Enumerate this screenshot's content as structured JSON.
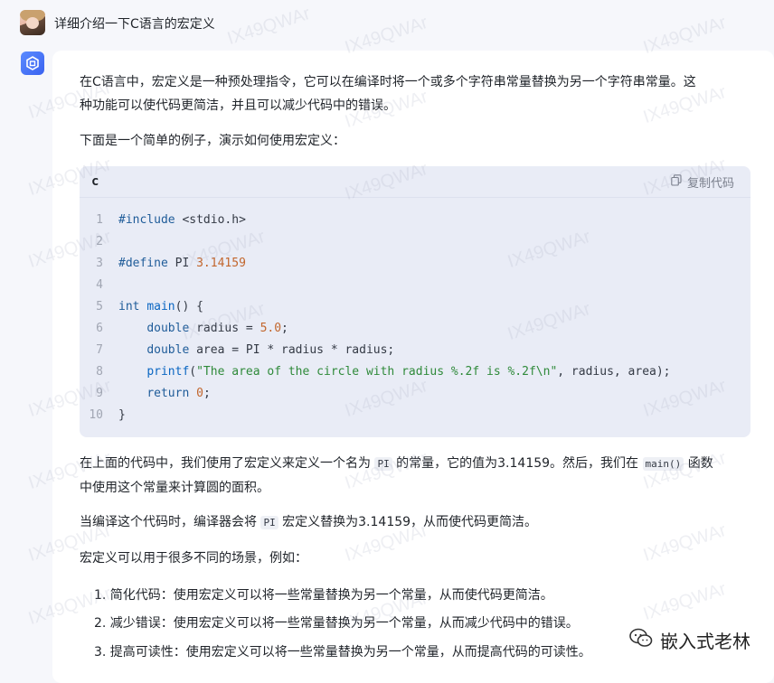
{
  "user": {
    "question": "详细介绍一下C语言的宏定义"
  },
  "answer": {
    "p1_line1": "在C语言中，宏定义是一种预处理指令，它可以在编译时将一个或多个字符串常量替换为另一个字符串常量。这",
    "p1_line2": "种功能可以使代码更简洁，并且可以减少代码中的错误。",
    "p2": "下面是一个简单的例子，演示如何使用宏定义：",
    "code": {
      "language": "c",
      "copy_label": "复制代码",
      "line_numbers": [
        "1",
        "2",
        "3",
        "4",
        "5",
        "6",
        "7",
        "8",
        "9",
        "10"
      ],
      "lines": [
        "#include <stdio.h>",
        "",
        "#define PI 3.14159",
        "",
        "int main() {",
        "    double radius = 5.0;",
        "    double area = PI * radius * radius;",
        "    printf(\"The area of the circle with radius %.2f is %.2f\\n\", radius, area);",
        "    return 0;",
        "}"
      ]
    },
    "p3_part1": "在上面的代码中，我们使用了宏定义来定义一个名为 ",
    "p3_code1": "PI",
    "p3_part2": " 的常量，它的值为3.14159。然后，我们在 ",
    "p3_code2": "main()",
    "p3_part3": " 函数",
    "p3_line2": "中使用这个常量来计算圆的面积。",
    "p4_part1": "当编译这个代码时，编译器会将 ",
    "p4_code": "PI",
    "p4_part2": " 宏定义替换为3.14159，从而使代码更简洁。",
    "p5": "宏定义可以用于很多不同的场景，例如：",
    "list": [
      "1. 简化代码：使用宏定义可以将一些常量替换为另一个常量，从而使代码更简洁。",
      "2. 减少错误：使用宏定义可以将一些常量替换为另一个常量，从而减少代码中的错误。",
      "3. 提高可读性：使用宏定义可以将一些常量替换为另一个常量，从而提高代码的可读性。"
    ]
  },
  "watermark": "IX49QWAr",
  "badge": {
    "text": "嵌入式老林",
    "icon": "wechat-icon"
  },
  "colors": {
    "accent": "#3a62f0",
    "code_bg": "#e9ecf6",
    "string": "#2f8a3a",
    "number": "#c2662d",
    "keyword": "#1f5c99"
  }
}
